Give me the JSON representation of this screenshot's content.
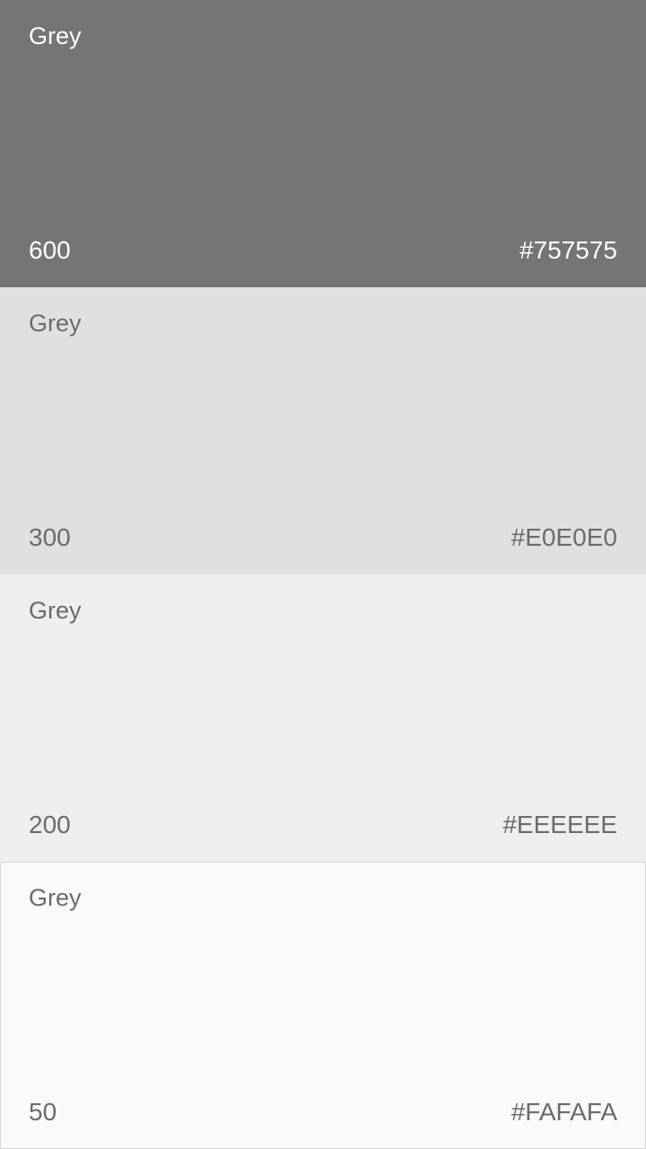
{
  "swatches": [
    {
      "name": "Grey",
      "shade": "600",
      "hex": "#757575",
      "background": "#757575",
      "text_color": "#FFFFFF"
    },
    {
      "name": "Grey",
      "shade": "300",
      "hex": "#E0E0E0",
      "background": "#E0E0E0",
      "text_color": "#6B6B6B"
    },
    {
      "name": "Grey",
      "shade": "200",
      "hex": "#EEEEEE",
      "background": "#EEEEEE",
      "text_color": "#6B6B6B"
    },
    {
      "name": "Grey",
      "shade": "50",
      "hex": "#FAFAFA",
      "background": "#FAFAFA",
      "text_color": "#6B6B6B"
    }
  ]
}
